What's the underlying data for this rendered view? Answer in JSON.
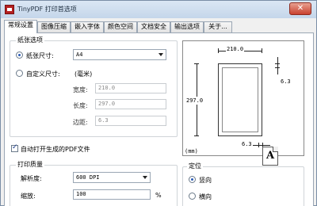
{
  "window": {
    "title": "TinyPDF 打印首选项",
    "close_glyph": "✕"
  },
  "tabs": [
    {
      "label": "常规设置",
      "active": true
    },
    {
      "label": "图像压缩"
    },
    {
      "label": "嵌入字体"
    },
    {
      "label": "颜色空间"
    },
    {
      "label": "文档安全"
    },
    {
      "label": "输出选项"
    },
    {
      "label": "关于..."
    }
  ],
  "paper": {
    "group_title": "纸张选项",
    "paper_size_label": "纸张尺寸:",
    "paper_size_value": "A4",
    "custom_size_label": "自定义尺寸:",
    "unit_label": "(毫米)",
    "width_label": "宽度:",
    "width_value": "210.0",
    "height_label": "长度:",
    "height_value": "297.0",
    "margin_label": "边距:",
    "margin_value": "6.3"
  },
  "auto_open": {
    "label": "自动打开生成的PDF文件",
    "checked": true
  },
  "quality": {
    "group_title": "打印质量",
    "resolution_label": "解析度:",
    "resolution_value": "600 DPI",
    "scale_label": "缩放:",
    "scale_value": "100",
    "percent": "%"
  },
  "preview": {
    "width_dim": "210.0",
    "height_dim": "297.0",
    "margin_right": "6.3",
    "margin_bottom": "6.3",
    "unit": "(mm)"
  },
  "orientation": {
    "group_title": "定位",
    "portrait_label": "竖向",
    "landscape_label": "横向",
    "icon_letter": "A"
  }
}
